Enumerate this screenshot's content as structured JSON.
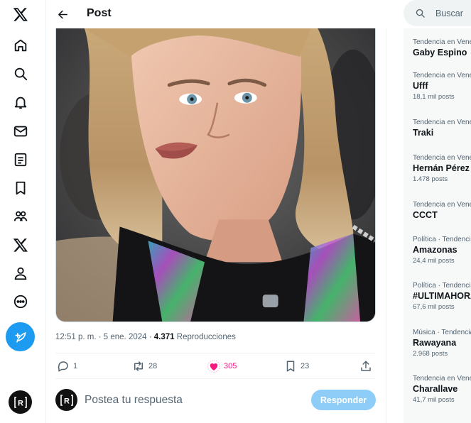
{
  "header": {
    "title": "Post"
  },
  "nav": {
    "items": [
      {
        "icon": "x-logo-icon"
      },
      {
        "icon": "home-icon"
      },
      {
        "icon": "search-icon"
      },
      {
        "icon": "bell-icon"
      },
      {
        "icon": "mail-icon"
      },
      {
        "icon": "list-icon"
      },
      {
        "icon": "bookmark-icon"
      },
      {
        "icon": "communities-icon"
      },
      {
        "icon": "premium-x-icon"
      },
      {
        "icon": "profile-icon"
      },
      {
        "icon": "more-icon"
      }
    ],
    "compose_icon": "feather-plus-icon",
    "account_initial": "R"
  },
  "post": {
    "time": "12:51 p. m.",
    "dot1": " · ",
    "date": "5 ene. 2024",
    "dot2": " · ",
    "views": "4.371",
    "views_label": " Reproducciones",
    "replies": "1",
    "reposts": "28",
    "likes": "305",
    "bookmarks": "23"
  },
  "reply": {
    "placeholder": "Postea tu respuesta",
    "button": "Responder",
    "avatar_initial": "R"
  },
  "search": {
    "placeholder": "Buscar"
  },
  "trends": [
    {
      "context": "Tendencia en Venezuela",
      "name": "Gaby Espino",
      "count": ""
    },
    {
      "context": "Tendencia en Venezuela",
      "name": "Ufff",
      "count": "18,1 mil posts"
    },
    {
      "context": "Tendencia en Venezuela",
      "name": "Traki",
      "count": ""
    },
    {
      "context": "Tendencia en Venezuela",
      "name": "Hernán Pérez",
      "count": "1.478 posts"
    },
    {
      "context": "Tendencia en Venezuela",
      "name": "CCCT",
      "count": ""
    },
    {
      "context": "Política · Tendencia",
      "name": "Amazonas",
      "count": "24,4 mil posts"
    },
    {
      "context": "Política · Tendencia",
      "name": "#ULTIMAHORA",
      "count": "67,6 mil posts"
    },
    {
      "context": "Música · Tendencia",
      "name": "Rawayana",
      "count": "2.968 posts"
    },
    {
      "context": "Tendencia en Venezuela",
      "name": "Charallave",
      "count": "41,7 mil posts"
    }
  ],
  "colors": {
    "accent": "#1d9bf0",
    "like": "#f91880",
    "reply_button": "#8ecdf7"
  }
}
